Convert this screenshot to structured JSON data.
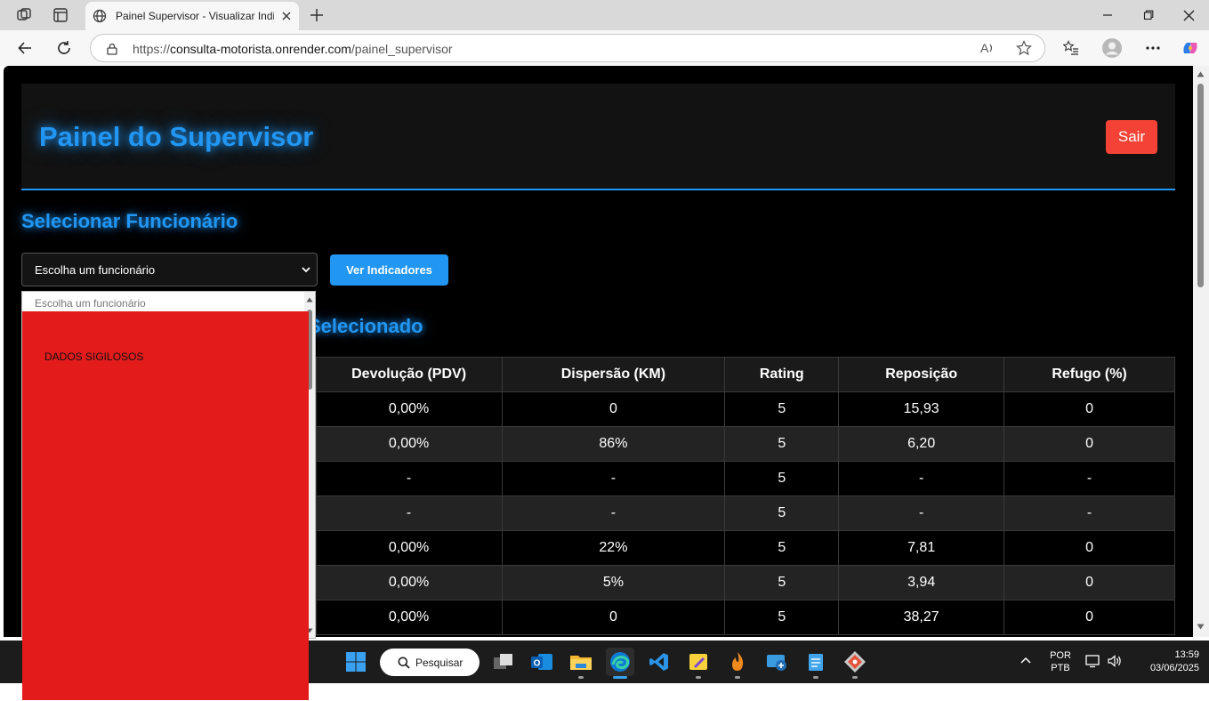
{
  "browser": {
    "tab_title": "Painel Supervisor - Visualizar Indicadores",
    "url_prefix": "https://",
    "url_host": "consulta-motorista.onrender.com",
    "url_path": "/painel_supervisor"
  },
  "page": {
    "header_title": "Painel do Supervisor",
    "logout_label": "Sair",
    "select_section_title": "Selecionar Funcionário",
    "select_value": "Escolha um funcionário",
    "view_button_label": "Ver Indicadores",
    "indicators_section_title": "Selecionado"
  },
  "table": {
    "headers": [
      "Devolução (PDV)",
      "Dispersão (KM)",
      "Rating",
      "Reposição",
      "Refugo (%)"
    ],
    "rows": [
      [
        "0,00%",
        "0",
        "5",
        "15,93",
        "0"
      ],
      [
        "0,00%",
        "86%",
        "5",
        "6,20",
        "0"
      ],
      [
        "-",
        "-",
        "5",
        "-",
        "-"
      ],
      [
        "-",
        "-",
        "5",
        "-",
        "-"
      ],
      [
        "0,00%",
        "22%",
        "5",
        "7,81",
        "0"
      ],
      [
        "0,00%",
        "5%",
        "5",
        "3,94",
        "0"
      ],
      [
        "0,00%",
        "0",
        "5",
        "38,27",
        "0"
      ]
    ]
  },
  "dropdown": {
    "placeholder_option": "Escolha um funcionário",
    "redaction_label": "DADOS SIGILOSOS"
  },
  "taskbar": {
    "search_label": "Pesquisar",
    "lang_top": "POR",
    "lang_bottom": "PTB",
    "time": "13:59",
    "date": "03/06/2025"
  },
  "colors": {
    "accent": "#2196f3",
    "danger": "#f44336",
    "redaction": "#e31b1b"
  }
}
